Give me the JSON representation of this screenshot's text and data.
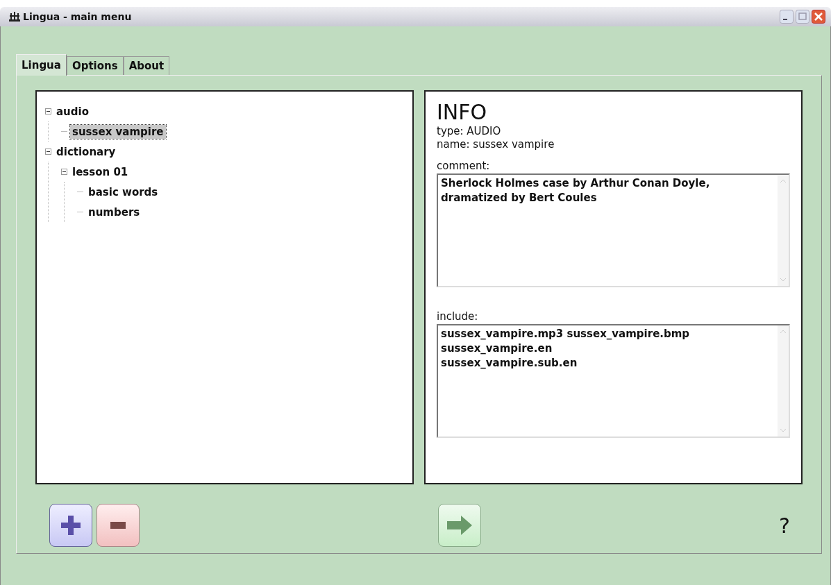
{
  "window": {
    "title": "Lingua - main menu"
  },
  "tabs": [
    {
      "label": "Lingua",
      "selected": true
    },
    {
      "label": "Options",
      "selected": false
    },
    {
      "label": "About",
      "selected": false
    }
  ],
  "tree": [
    {
      "label": "audio",
      "expanded": true,
      "selected": false,
      "children": [
        {
          "label": "sussex vampire",
          "selected": true
        }
      ]
    },
    {
      "label": "dictionary",
      "expanded": true,
      "selected": false,
      "children": [
        {
          "label": "lesson 01",
          "expanded": true,
          "selected": false,
          "children": [
            {
              "label": "basic words",
              "selected": false
            },
            {
              "label": "numbers",
              "selected": false
            }
          ]
        }
      ]
    }
  ],
  "info": {
    "heading": "INFO",
    "type": "type: AUDIO",
    "name": "name: sussex vampire",
    "comment_label": "comment:",
    "comment": "Sherlock Holmes case by Arthur Conan Doyle, dramatized by Bert Coules",
    "include_label": "include:",
    "include": [
      "sussex_vampire.mp3 sussex_vampire.bmp",
      "sussex_vampire.en",
      "sussex_vampire.sub.en"
    ]
  },
  "help": "?"
}
